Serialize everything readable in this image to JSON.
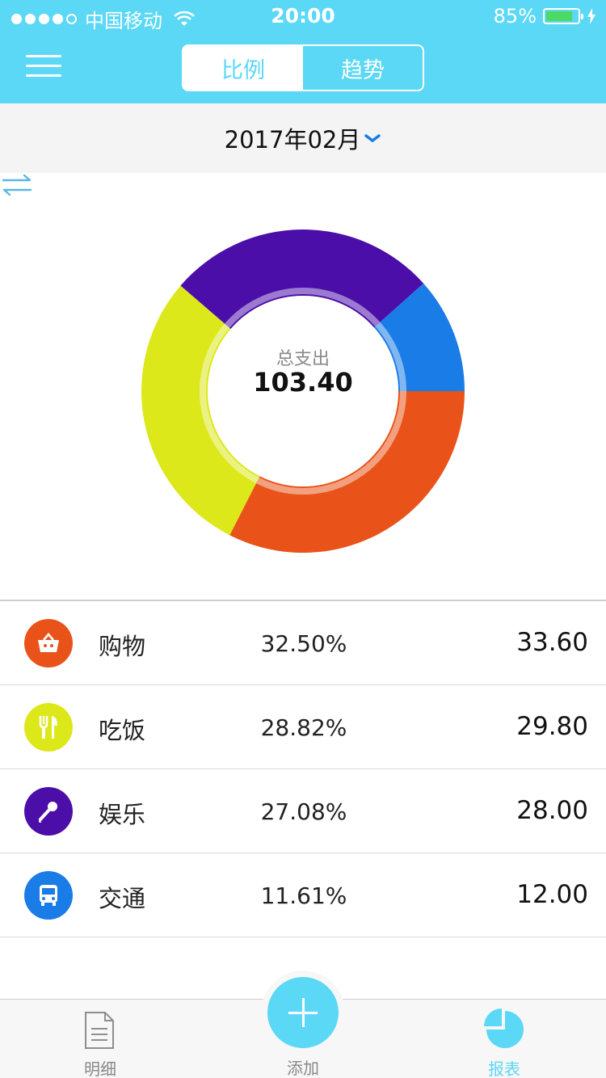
{
  "status_bar": {
    "carrier": "中国移动",
    "time": "20:00",
    "battery": "85%",
    "battery_level": 0.85
  },
  "header": {
    "tabs": [
      {
        "label": "比例",
        "active": true
      },
      {
        "label": "趋势",
        "active": false
      }
    ]
  },
  "month_selector": {
    "label": "2017年02月"
  },
  "chart_data": {
    "type": "pie",
    "center_title": "总支出",
    "center_value": "103.40",
    "slices": [
      {
        "name": "购物",
        "value": 33.6,
        "percent": "32.50%",
        "color": "#E95319",
        "icon": "basket-icon"
      },
      {
        "name": "吃饭",
        "value": 29.8,
        "percent": "28.82%",
        "color": "#DDE81A",
        "icon": "fork-knife-icon"
      },
      {
        "name": "娱乐",
        "value": 28.0,
        "percent": "27.08%",
        "color": "#4C0EA8",
        "icon": "microphone-icon"
      },
      {
        "name": "交通",
        "value": 12.0,
        "percent": "11.61%",
        "color": "#1A7CE6",
        "icon": "bus-icon"
      }
    ]
  },
  "list": {
    "items": [
      {
        "name": "购物",
        "percent": "32.50%",
        "amount": "33.60"
      },
      {
        "name": "吃饭",
        "percent": "28.82%",
        "amount": "29.80"
      },
      {
        "name": "娱乐",
        "percent": "27.08%",
        "amount": "28.00"
      },
      {
        "name": "交通",
        "percent": "11.61%",
        "amount": "12.00"
      }
    ]
  },
  "tabbar": {
    "detail_label": "明细",
    "add_label": "添加",
    "report_label": "报表"
  },
  "colors": {
    "accent": "#5AD8F6",
    "shopping": "#E95319",
    "dining": "#DDE81A",
    "entertainment": "#4C0EA8",
    "transport": "#1A7CE6"
  }
}
